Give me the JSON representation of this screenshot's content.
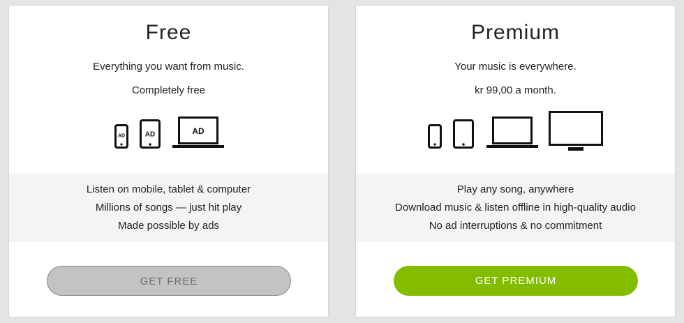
{
  "plans": {
    "free": {
      "name": "Free",
      "tagline": "Everything you want from music.",
      "price_note": "Completely free",
      "device_ad_labels": [
        "AD",
        "AD",
        "AD"
      ],
      "devices": [
        "phone-icon",
        "tablet-icon",
        "laptop-icon"
      ],
      "features": [
        "Listen on mobile, tablet & computer",
        "Millions of songs — just hit play",
        "Made possible by ads"
      ],
      "button_label": "GET FREE"
    },
    "premium": {
      "name": "Premium",
      "tagline": "Your music is everywhere.",
      "price_note": "kr 99,00 a month.",
      "devices": [
        "phone-icon",
        "tablet-icon",
        "laptop-icon",
        "tv-icon"
      ],
      "features": [
        "Play any song, anywhere",
        "Download music & listen offline in high-quality audio",
        "No ad interruptions & no commitment"
      ],
      "button_label": "GET PREMIUM"
    }
  },
  "colors": {
    "background": "#e3e4e4",
    "card": "#ffffff",
    "feature_band": "#f4f4f4",
    "free_button": "#c3c3c3",
    "premium_button": "#84bd00"
  }
}
